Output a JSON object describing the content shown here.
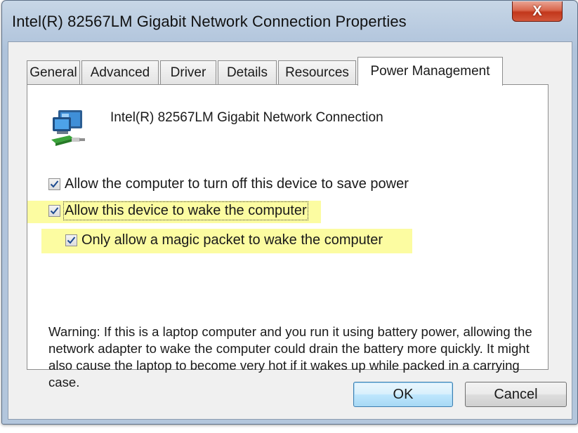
{
  "window": {
    "title": "Intel(R) 82567LM Gigabit Network Connection Properties",
    "close_glyph": "X"
  },
  "tabs": [
    {
      "label": "General",
      "active": false
    },
    {
      "label": "Advanced",
      "active": false
    },
    {
      "label": "Driver",
      "active": false
    },
    {
      "label": "Details",
      "active": false
    },
    {
      "label": "Resources",
      "active": false
    },
    {
      "label": "Power Management",
      "active": true
    }
  ],
  "device": {
    "icon": "network-adapter-icon",
    "name": "Intel(R) 82567LM Gigabit Network Connection"
  },
  "options": [
    {
      "label": "Allow the computer to turn off this device to save power",
      "checked": true,
      "highlighted": false
    },
    {
      "label": "Allow this device to wake the computer",
      "checked": true,
      "highlighted": true
    },
    {
      "label": "Only allow a magic packet to wake the computer",
      "checked": true,
      "highlighted": true
    }
  ],
  "warning": "Warning: If this is a laptop computer and you run it using battery power, allowing the network adapter to wake the computer could drain the battery more quickly. It might also cause the laptop to become very hot if it wakes up while packed in a carrying case.",
  "buttons": {
    "ok": "OK",
    "cancel": "Cancel"
  },
  "colors": {
    "highlight": "#fcfca1",
    "close_button": "#c2371b",
    "ok_button": "#bee6fd"
  }
}
